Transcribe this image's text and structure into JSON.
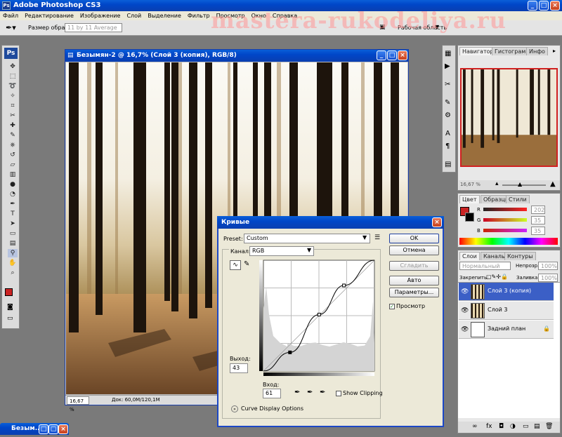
{
  "app": {
    "title": "Adobe Photoshop CS3",
    "icon": "ps-icon"
  },
  "menu": [
    "Файл",
    "Редактирование",
    "Изображение",
    "Слой",
    "Выделение",
    "Фильтр",
    "Просмотр",
    "Окно",
    "Справка"
  ],
  "options_bar": {
    "sample_label": "Размер образца:",
    "sample_value": "11 by 11 Average",
    "workspace_label": "Рабочая область"
  },
  "watermark": "mastera-rukodeliya.ru",
  "document": {
    "title": "Безымян-2 @ 16,7% (Слой 3 (копия), RGB/8)",
    "zoom": "16,67 %",
    "doc_size": "Док: 60,0M/120,1M"
  },
  "minimized_doc": {
    "title": "Безым..."
  },
  "toolbox": {
    "logo": "Ps",
    "tools": [
      "move-icon",
      "marquee-icon",
      "lasso-icon",
      "magic-wand-icon",
      "crop-icon",
      "slice-icon",
      "healing-icon",
      "brush-icon",
      "clone-stamp-icon",
      "history-brush-icon",
      "eraser-icon",
      "gradient-icon",
      "blur-icon",
      "dodge-icon",
      "pen-icon",
      "type-icon",
      "path-select-icon",
      "shape-icon",
      "notes-icon",
      "eyedropper-icon",
      "hand-icon",
      "zoom-icon"
    ]
  },
  "navigator": {
    "tabs": [
      "Навигатор",
      "Гистограмма",
      "Инфо"
    ],
    "zoom": "16,67 %"
  },
  "color_panel": {
    "tabs": [
      "Цвет",
      "Образцы",
      "Стили"
    ],
    "r_label": "R",
    "g_label": "G",
    "b_label": "B",
    "r": "202",
    "g": "35",
    "b": "35"
  },
  "layers_panel": {
    "tabs": [
      "Слои",
      "Каналы",
      "Контуры"
    ],
    "blend_mode": "Нормальный",
    "opacity_label": "Непрозр.:",
    "opacity": "100%",
    "lock_label": "Закрепить:",
    "fill_label": "Заливка:",
    "fill": "100%",
    "layers": [
      {
        "name": "Слой 3 (копия)",
        "selected": true
      },
      {
        "name": "Слой 3",
        "selected": false
      },
      {
        "name": "Задний план",
        "selected": false
      }
    ]
  },
  "curves": {
    "title": "Кривые",
    "preset_label": "Preset:",
    "preset_value": "Custom",
    "channel_label": "Канал:",
    "channel_value": "RGB",
    "ok": "OK",
    "cancel": "Отмена",
    "smooth": "Сгладить",
    "auto": "Авто",
    "options": "Параметры...",
    "preview": "Просмотр",
    "preview_checked": true,
    "output_label": "Выход:",
    "output_value": "43",
    "input_label": "Вход:",
    "input_value": "61",
    "show_clipping": "Show Clipping",
    "show_clipping_checked": false,
    "display_options": "Curve Display Options",
    "curve_points": [
      {
        "in": 0,
        "out": 0
      },
      {
        "in": 61,
        "out": 43
      },
      {
        "in": 128,
        "out": 130
      },
      {
        "in": 185,
        "out": 197
      },
      {
        "in": 255,
        "out": 255
      }
    ]
  }
}
